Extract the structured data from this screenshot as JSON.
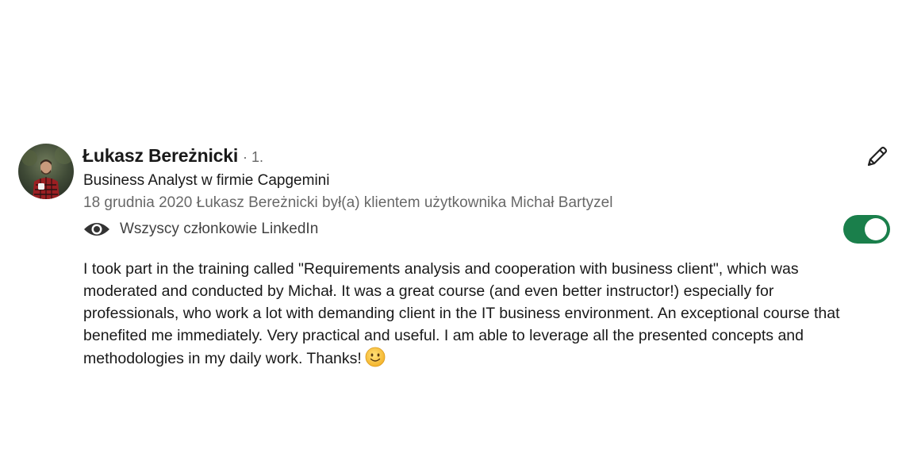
{
  "recommendation": {
    "author_name": "Łukasz Bereżnicki",
    "connection_degree": "· 1.",
    "headline": "Business Analyst w firmie Capgemini",
    "meta": "18 grudnia 2020 Łukasz Bereżnicki był(a) klientem użytkownika Michał Bartyzel",
    "visibility_label": "Wszyscy członkowie LinkedIn",
    "visibility_icon": "eye-icon",
    "edit_icon": "pencil-icon",
    "toggle_on": true,
    "toggle_color": "#1a7f4b",
    "body_lines": [
      "I took part in the training called \"Requirements analysis and cooperation with business client\", which was",
      "moderated and conducted by Michał. It was a great course (and even better instructor!) especially for",
      "professionals, who work a lot with demanding client in the IT business environment. An exceptional course that",
      "benefited me immediately. Very practical and useful. I am able to leverage all the presented concepts and",
      "methodologies in my daily work. Thanks!"
    ],
    "emoji": "slightly-smiling-face-icon"
  }
}
